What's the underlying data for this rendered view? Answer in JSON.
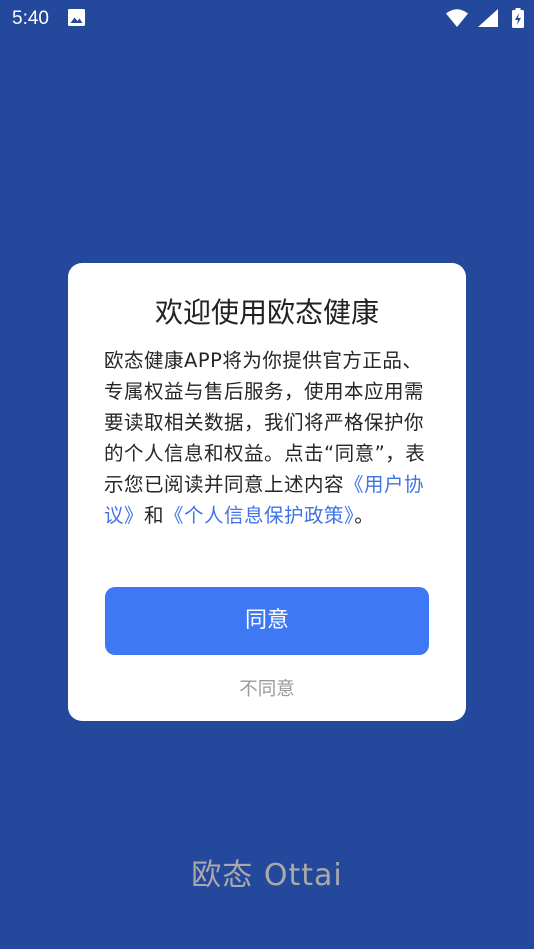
{
  "status_bar": {
    "time": "5:40",
    "icons": [
      "image-icon",
      "wifi-icon",
      "signal-icon",
      "battery-icon"
    ]
  },
  "dialog": {
    "title": "欢迎使用欧态健康",
    "body_text": "欧态健康APP将为你提供官方正品、专属权益与售后服务，使用本应用需要读取相关数据，我们将严格保护你的个人信息和权益。点击“同意”，表示您已阅读并同意上述内容",
    "user_agreement_link": "《用户协议》",
    "connector": "和",
    "privacy_policy_link": "《个人信息保护政策》",
    "ending": "。",
    "agree_label": "同意",
    "disagree_label": "不同意"
  },
  "footer": {
    "logo_text": "欧态 Ottai"
  },
  "colors": {
    "background": "#24499C",
    "accent": "#3F78F5",
    "link": "#3F73E6",
    "muted_text": "#9A9A9A"
  }
}
